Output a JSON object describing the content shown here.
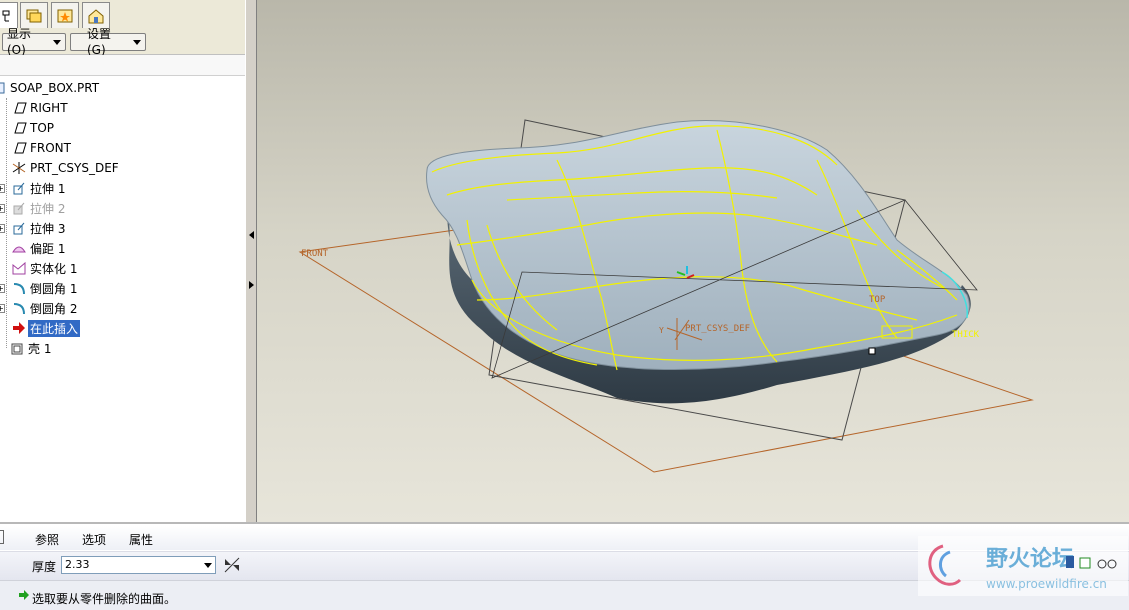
{
  "tabs": [
    {
      "icon": "model-tree-icon"
    },
    {
      "icon": "folder-browser-icon"
    },
    {
      "icon": "favorites-icon"
    },
    {
      "icon": "connections-icon"
    }
  ],
  "toolbar": {
    "show_label": "显示 (O)",
    "settings_label": "设置 (G)"
  },
  "model_tree": {
    "root": "SOAP_BOX.PRT",
    "items": [
      {
        "label": "RIGHT",
        "icon": "datum-plane-icon"
      },
      {
        "label": "TOP",
        "icon": "datum-plane-icon"
      },
      {
        "label": "FRONT",
        "icon": "datum-plane-icon"
      },
      {
        "label": "PRT_CSYS_DEF",
        "icon": "coordinate-system-icon"
      },
      {
        "label": "拉伸 1",
        "icon": "extrude-icon"
      },
      {
        "label": "拉伸 2",
        "icon": "extrude-icon"
      },
      {
        "label": "拉伸 3",
        "icon": "extrude-icon"
      },
      {
        "label": "偏距 1",
        "icon": "offset-icon"
      },
      {
        "label": "实体化 1",
        "icon": "solidify-icon"
      },
      {
        "label": "倒圆角 1",
        "icon": "round-icon"
      },
      {
        "label": "倒圆角 2",
        "icon": "round-icon"
      },
      {
        "label": "在此插入",
        "icon": "insert-arrow-icon"
      },
      {
        "label": "壳 1",
        "icon": "shell-icon"
      }
    ]
  },
  "viewport": {
    "labels": {
      "front": "FRONT",
      "top": "TOP",
      "csys": "PRT_CSYS_DEF",
      "thick": "THICK",
      "csys_axis": "Y"
    },
    "colors": {
      "datum_plane": "#b5652a",
      "edge": "#ffff00",
      "body": "#a9b9c4"
    }
  },
  "dashboard": {
    "tabs": [
      "参照",
      "选项",
      "属性"
    ],
    "thickness_label": "厚度",
    "thickness_value": "2.33",
    "status_message": "选取要从零件删除的曲面。"
  },
  "watermark": {
    "title": "野火论坛",
    "url": "www.proewildfire.cn"
  }
}
